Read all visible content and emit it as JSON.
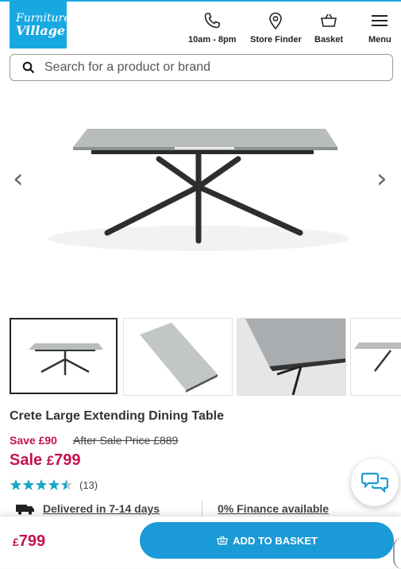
{
  "brand": {
    "logo_line1": "Furniture",
    "logo_line2": "Village"
  },
  "header": {
    "nav": [
      {
        "label": "10am - 8pm",
        "icon": "phone-icon"
      },
      {
        "label": "Store Finder",
        "icon": "location-pin-icon"
      },
      {
        "label": "Basket",
        "icon": "basket-icon"
      },
      {
        "label": "Menu",
        "icon": "hamburger-menu-icon"
      }
    ]
  },
  "search": {
    "placeholder": "Search for a product or brand"
  },
  "gallery": {
    "prev": "‹",
    "next": "›"
  },
  "product": {
    "title": "Crete Large Extending Dining Table",
    "save_label": "Save £90",
    "after_sale_label": "After Sale Price £889",
    "sale_label": "Sale ",
    "sale_currency": "£",
    "sale_price": "799",
    "rating": 4.5,
    "review_count": "(13)",
    "delivery": "Delivered in 7-14 days",
    "finance": "0% Finance available"
  },
  "bottom_bar": {
    "currency": "£",
    "price": "799",
    "button_label": "ADD TO BASKET"
  },
  "colors": {
    "accent": "#1a9ad6",
    "brand": "#17a8e1",
    "sale": "#c4134d",
    "stars": "#1aa7c9"
  }
}
